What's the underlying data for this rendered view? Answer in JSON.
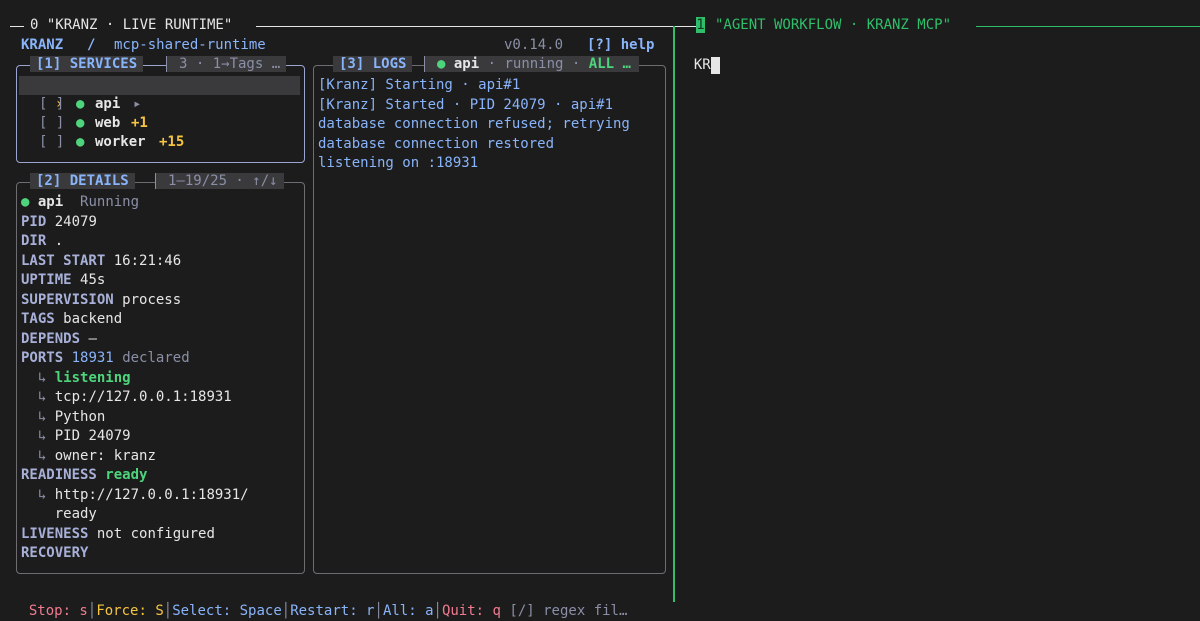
{
  "tmux": {
    "pane0_title": "0 \"KRANZ · LIVE RUNTIME\"",
    "pane1_index": "1",
    "pane1_title": "\"AGENT WORKFLOW · KRANZ MCP\""
  },
  "header": {
    "app": "KRANZ",
    "separator": "/",
    "project": "mcp-shared-runtime",
    "version": "v0.14.0",
    "help": "[?] help"
  },
  "services": {
    "title": "[1] SERVICES",
    "meta": "3 · 1→Tags …",
    "items": [
      {
        "cursor": "›",
        "check": "[ ]",
        "name": "api",
        "extra": "▸"
      },
      {
        "cursor": "",
        "check": "[ ]",
        "name": "web",
        "extra": "+1"
      },
      {
        "cursor": "",
        "check": "[ ]",
        "name": "worker",
        "extra": "+15"
      }
    ]
  },
  "details": {
    "title": "[2] DETAILS",
    "meta": "1–19/25 · ↑/↓",
    "service": "api",
    "state": "Running",
    "pid_label": "PID",
    "pid": "24079",
    "dir_label": "DIR",
    "dir": ".",
    "last_start_label": "LAST START",
    "last_start": "16:21:46",
    "uptime_label": "UPTIME",
    "uptime": "45s",
    "supervision_label": "SUPERVISION",
    "supervision": "process",
    "tags_label": "TAGS",
    "tags": "backend",
    "depends_label": "DEPENDS",
    "depends": "—",
    "ports_label": "PORTS",
    "ports_value": "18931",
    "ports_state": "declared",
    "port_listening": "listening",
    "port_addr": "tcp://127.0.0.1:18931",
    "port_proc": "Python",
    "port_pid": "PID 24079",
    "port_owner": "owner: kranz",
    "readiness_label": "READINESS",
    "readiness": "ready",
    "readiness_url": "http://127.0.0.1:18931/",
    "readiness_url_cont": "ready",
    "liveness_label": "LIVENESS",
    "liveness": "not configured",
    "recovery_label": "RECOVERY",
    "arrow": "↳"
  },
  "logs": {
    "title": "[3] LOGS",
    "service": "api",
    "state": "· running ·",
    "filter": "ALL …",
    "lines": [
      "[Kranz] Starting · api#1",
      "[Kranz] Started · PID 24079 · api#1",
      "database connection refused; retrying",
      "database connection restored",
      "listening on :18931"
    ]
  },
  "footer": {
    "stop": "Stop: s",
    "force": "Force: S",
    "select": "Select: Space",
    "restart": "Restart: r",
    "all": "All: a",
    "quit": "Quit: q",
    "regex": "[/] regex fil…"
  },
  "agent": {
    "input": "KR"
  },
  "colors": {
    "accent_blue": "#89b4fa",
    "green": "#4ed47c",
    "yellow": "#f5c542",
    "red": "#f07b8f",
    "tmux_green": "#2fbf6a"
  }
}
